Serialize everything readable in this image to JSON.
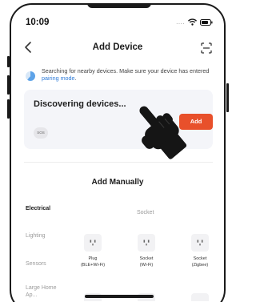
{
  "status": {
    "time": "10:09",
    "signal_dots": "....",
    "wifi": "wifi-icon",
    "battery": "battery-icon"
  },
  "nav": {
    "back": "chevron-left-icon",
    "title": "Add Device",
    "scan": "scan-icon"
  },
  "search_info": {
    "text": "Searching for nearby devices. Make sure your device has entered",
    "link": "pairing mode",
    "suffix": "."
  },
  "discovering": {
    "title": "Discovering devices...",
    "device_badge": "SOS",
    "add_label": "Add"
  },
  "manual": {
    "title": "Add Manually",
    "categories": [
      "Electrical",
      "Lighting",
      "Sensors",
      "Large Home Ap..."
    ],
    "active_category": "Electrical",
    "group_label": "Socket",
    "devices": [
      {
        "line1": "Plug",
        "line2": "(BLE+Wi-Fi)"
      },
      {
        "line1": "Socket",
        "line2": "(Wi-Fi)"
      },
      {
        "line1": "Socket",
        "line2": "(Zigbee)"
      }
    ]
  },
  "colors": {
    "accent": "#e8502b",
    "link": "#2d7bd8",
    "card_bg": "#f4f5f9"
  }
}
